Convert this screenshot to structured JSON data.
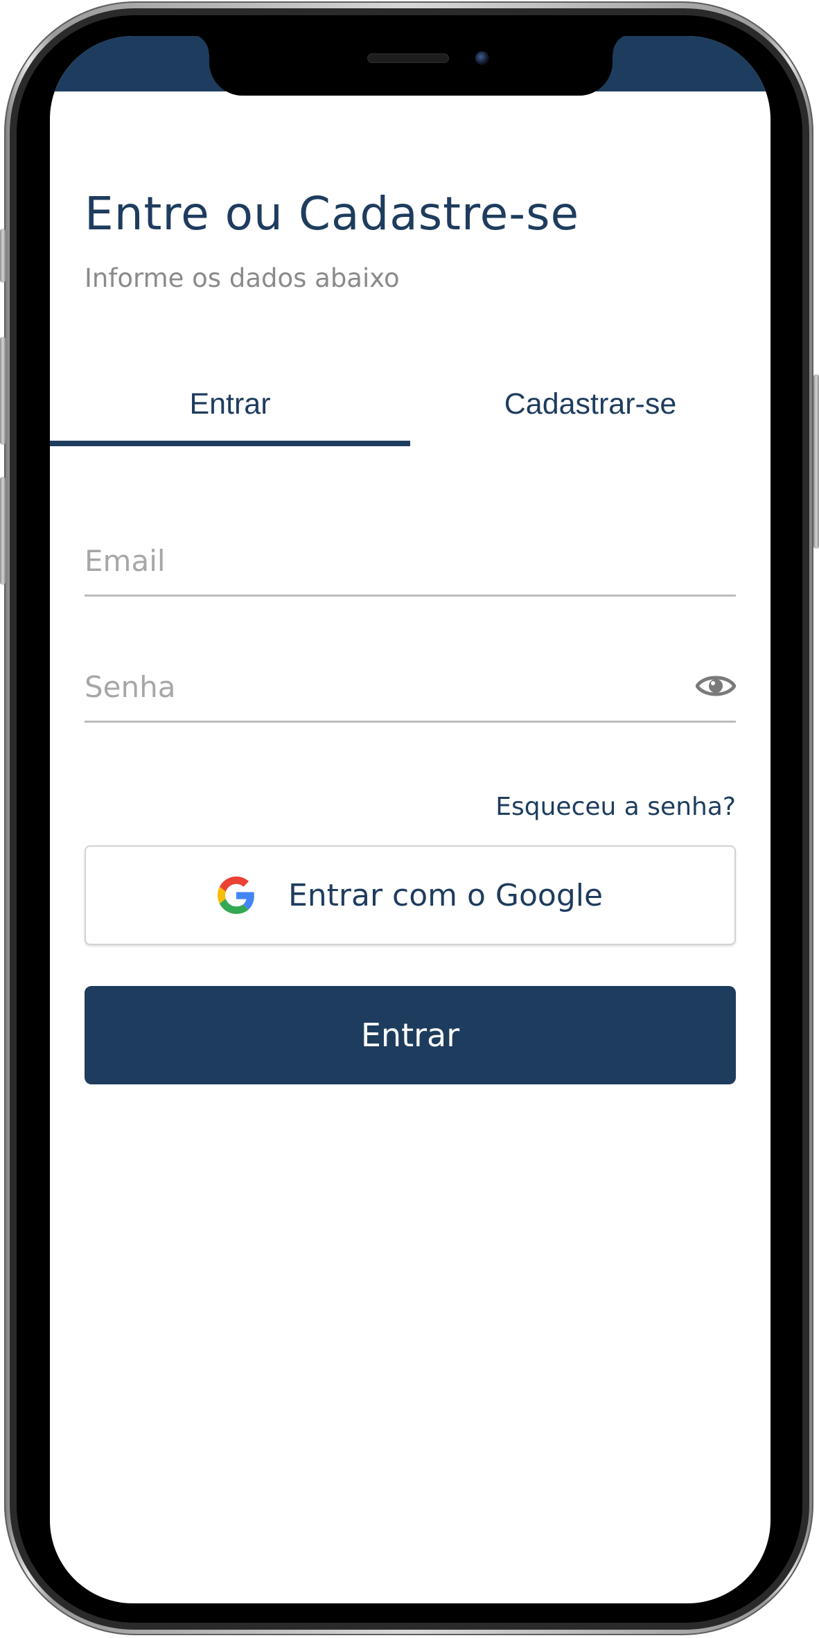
{
  "header": {
    "title": "Entre ou Cadastre-se",
    "subtitle": "Informe os dados abaixo"
  },
  "tabs": [
    {
      "label": "Entrar",
      "active": true
    },
    {
      "label": "Cadastrar-se",
      "active": false
    }
  ],
  "form": {
    "email": {
      "placeholder": "Email",
      "value": ""
    },
    "password": {
      "placeholder": "Senha",
      "value": ""
    },
    "show_password_icon": "eye-icon",
    "forgot_password": "Esqueceu a senha?",
    "google_button": "Entrar com o Google",
    "google_icon": "google-logo-icon",
    "submit_button": "Entrar"
  },
  "colors": {
    "primary": "#1e3c5e",
    "muted_text": "#8a8a8a",
    "placeholder": "#a7a7a7",
    "divider": "#bcbcbc",
    "background": "#ffffff"
  }
}
